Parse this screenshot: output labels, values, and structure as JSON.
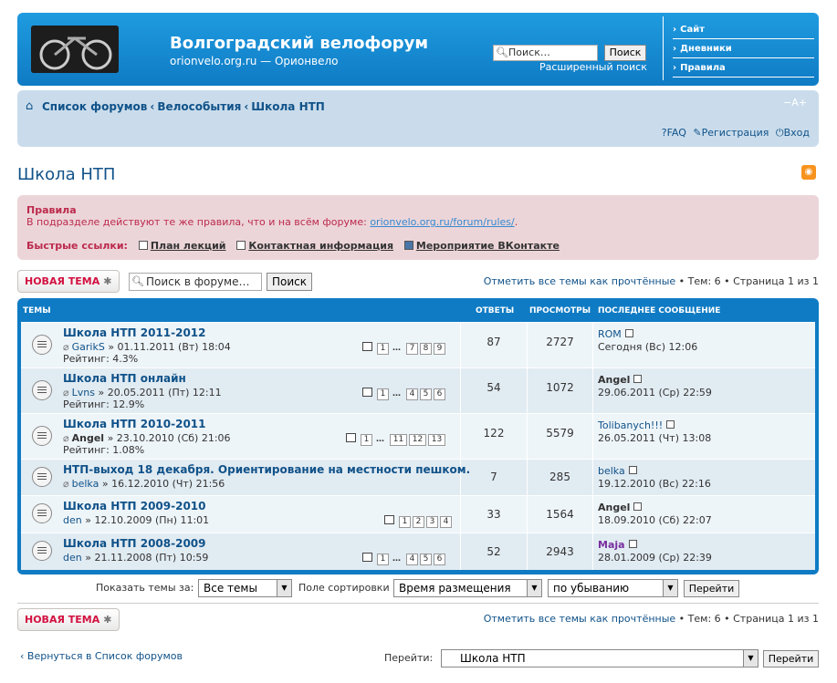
{
  "header": {
    "title": "Волгоградский велофорум",
    "description": "orionvelo.org.ru — Орионвело",
    "search_placeholder": "Поиск…",
    "search_button": "Поиск",
    "advanced_search": "Расширенный поиск",
    "nav": [
      "Сайт",
      "Дневники",
      "Правила"
    ]
  },
  "navbar": {
    "breadcrumb": [
      "Список форумов",
      "Велособытия",
      "Школа НТП"
    ],
    "font_size": "−A+",
    "faq": "FAQ",
    "register": "Регистрация",
    "login": "Вход"
  },
  "page_title": "Школа НТП",
  "rules": {
    "title": "Правила",
    "text": "В подразделе действуют те же правила, что и на всём форуме: ",
    "link": "orionvelo.org.ru/forum/rules/",
    "text_end": ".",
    "quick_label": "Быстрые ссылки:",
    "quick_links": [
      "План лекций",
      "Контактная информация",
      "Мероприятие ВКонтакте"
    ]
  },
  "actions": {
    "new_topic": "НОВАЯ ТЕМА",
    "forum_search_placeholder": "Поиск в форуме…",
    "forum_search_button": "Поиск",
    "mark_read": "Отметить все темы как прочтённые",
    "topics_count": " • Тем: 6 • Страница ",
    "page_current": "1",
    "page_of": " из ",
    "page_total": "1"
  },
  "table_headers": {
    "topics": "Темы",
    "replies": "Ответы",
    "views": "Просмотры",
    "last_post": "Последнее сообщение"
  },
  "topics": [
    {
      "title": "Школа НТП 2011-2012",
      "author": "GarikS",
      "date": "» 01.11.2011 (Вт) 18:04",
      "rating": "Рейтинг: 4.3%",
      "pages": [
        "1",
        "7",
        "8",
        "9"
      ],
      "replies": "87",
      "views": "2727",
      "last_user": "ROM",
      "last_time": "Сегодня (Вс) 12:06"
    },
    {
      "title": "Школа НТП онлайн",
      "author": "Lvns",
      "date": "» 20.05.2011 (Пт) 12:11",
      "rating": "Рейтинг: 12.9%",
      "pages": [
        "1",
        "4",
        "5",
        "6"
      ],
      "replies": "54",
      "views": "1072",
      "last_user": "Angel",
      "last_time": "29.06.2011 (Ср) 22:59"
    },
    {
      "title": "Школа НТП 2010-2011",
      "author": "Angel",
      "date": "» 23.10.2010 (Сб) 21:06",
      "rating": "Рейтинг: 1.08%",
      "pages": [
        "1",
        "11",
        "12",
        "13"
      ],
      "replies": "122",
      "views": "5579",
      "last_user": "Tolibanych!!!",
      "last_time": "26.05.2011 (Чт) 13:08"
    },
    {
      "title": "НТП-выход 18 декабря. Ориентирование на местности пешком.",
      "author": "belka",
      "date": "» 16.12.2010 (Чт) 21:56",
      "replies": "7",
      "views": "285",
      "last_user": "belka",
      "last_time": "19.12.2010 (Вс) 22:16"
    },
    {
      "title": "Школа НТП 2009-2010",
      "author": "den",
      "date": "» 12.10.2009 (Пн) 11:01",
      "pages": [
        "1",
        "2",
        "3",
        "4"
      ],
      "replies": "33",
      "views": "1564",
      "last_user": "Angel",
      "last_time": "18.09.2010 (Сб) 22:07"
    },
    {
      "title": "Школа НТП 2008-2009",
      "author": "den",
      "date": "» 21.11.2008 (Пт) 10:59",
      "pages": [
        "1",
        "4",
        "5",
        "6"
      ],
      "replies": "52",
      "views": "2943",
      "last_user": "Maja",
      "last_time": "28.01.2009 (Ср) 22:39"
    }
  ],
  "sort": {
    "show_label": "Показать темы за:",
    "show_value": "Все темы",
    "sort_label": "Поле сортировки",
    "sort_value": "Время размещения",
    "order_value": "по убыванию",
    "go": "Перейти"
  },
  "footer": {
    "back": "Вернуться в Список форумов",
    "jump_label": "Перейти:",
    "jump_value": "Школа НТП",
    "jump_button": "Перейти"
  },
  "colors": {
    "header": "#1a8fd6",
    "navbar": "#cadceb",
    "rules_bg": "#ecd5d8",
    "rules_text": "#bc2a4d",
    "link": "#105289"
  }
}
